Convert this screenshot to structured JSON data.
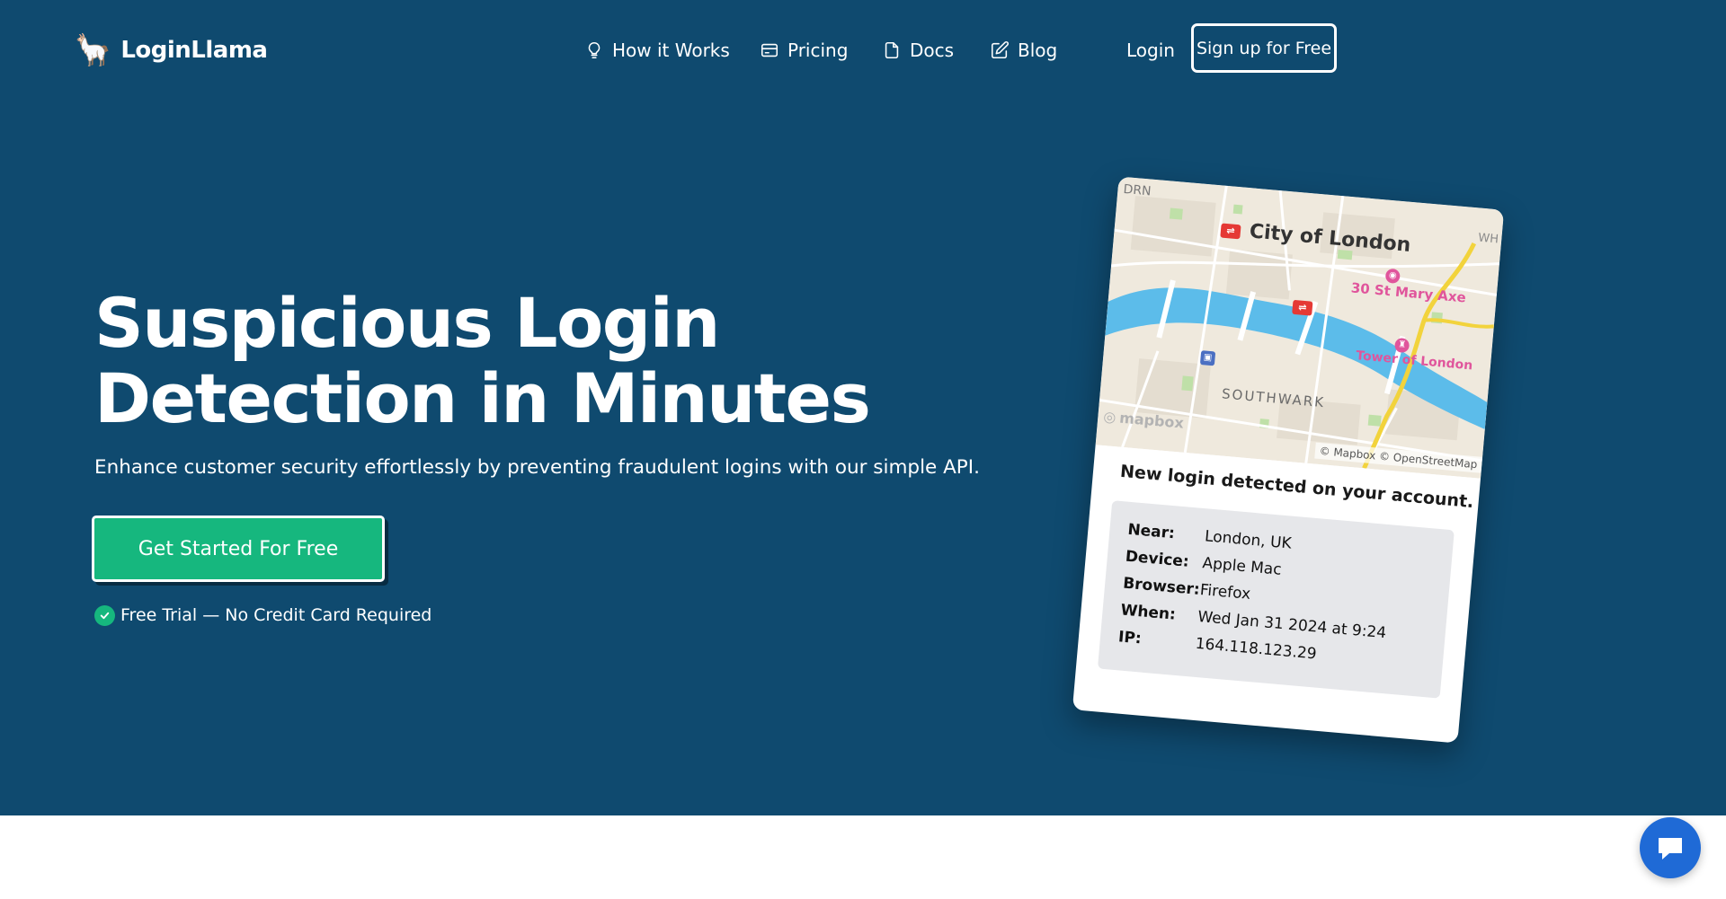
{
  "brand": {
    "name": "LoginLlama",
    "icon": "llama-icon"
  },
  "nav": {
    "items": [
      {
        "label": "How it Works",
        "icon": "lightbulb-icon"
      },
      {
        "label": "Pricing",
        "icon": "credit-card-icon"
      },
      {
        "label": "Docs",
        "icon": "document-icon"
      },
      {
        "label": "Blog",
        "icon": "pencil-square-icon"
      }
    ],
    "login": "Login",
    "signup": "Sign up for Free"
  },
  "hero": {
    "headline": "Suspicious Login Detection in Minutes",
    "subheadline": "Enhance customer security effortlessly by preventing fraudulent logins with our simple API.",
    "cta": "Get Started For Free",
    "trial_note": "Free Trial — No Credit Card Required"
  },
  "card": {
    "map": {
      "labels": {
        "city": "City of London",
        "poi1": "30 St Mary Axe",
        "poi2": "Tower of London",
        "district": "SOUTHWARK",
        "corner_left": "DRN",
        "corner_right": "WH"
      },
      "logo": "mapbox",
      "attribution": "© Mapbox © OpenStreetMap"
    },
    "title": "New login detected on your account.",
    "details": [
      {
        "key": "Near:",
        "value": "London, UK"
      },
      {
        "key": "Device:",
        "value": "Apple Mac"
      },
      {
        "key": "Browser:",
        "value": "Firefox"
      },
      {
        "key": "When:",
        "value": "Wed Jan 31 2024 at 9:24"
      },
      {
        "key": "IP:",
        "value": "164.118.123.29"
      }
    ]
  },
  "colors": {
    "hero_bg": "#0f4a6f",
    "cta_green": "#16b77e",
    "chat_blue": "#1f6ad6"
  },
  "chat": {
    "icon": "chat-bubble-icon"
  }
}
